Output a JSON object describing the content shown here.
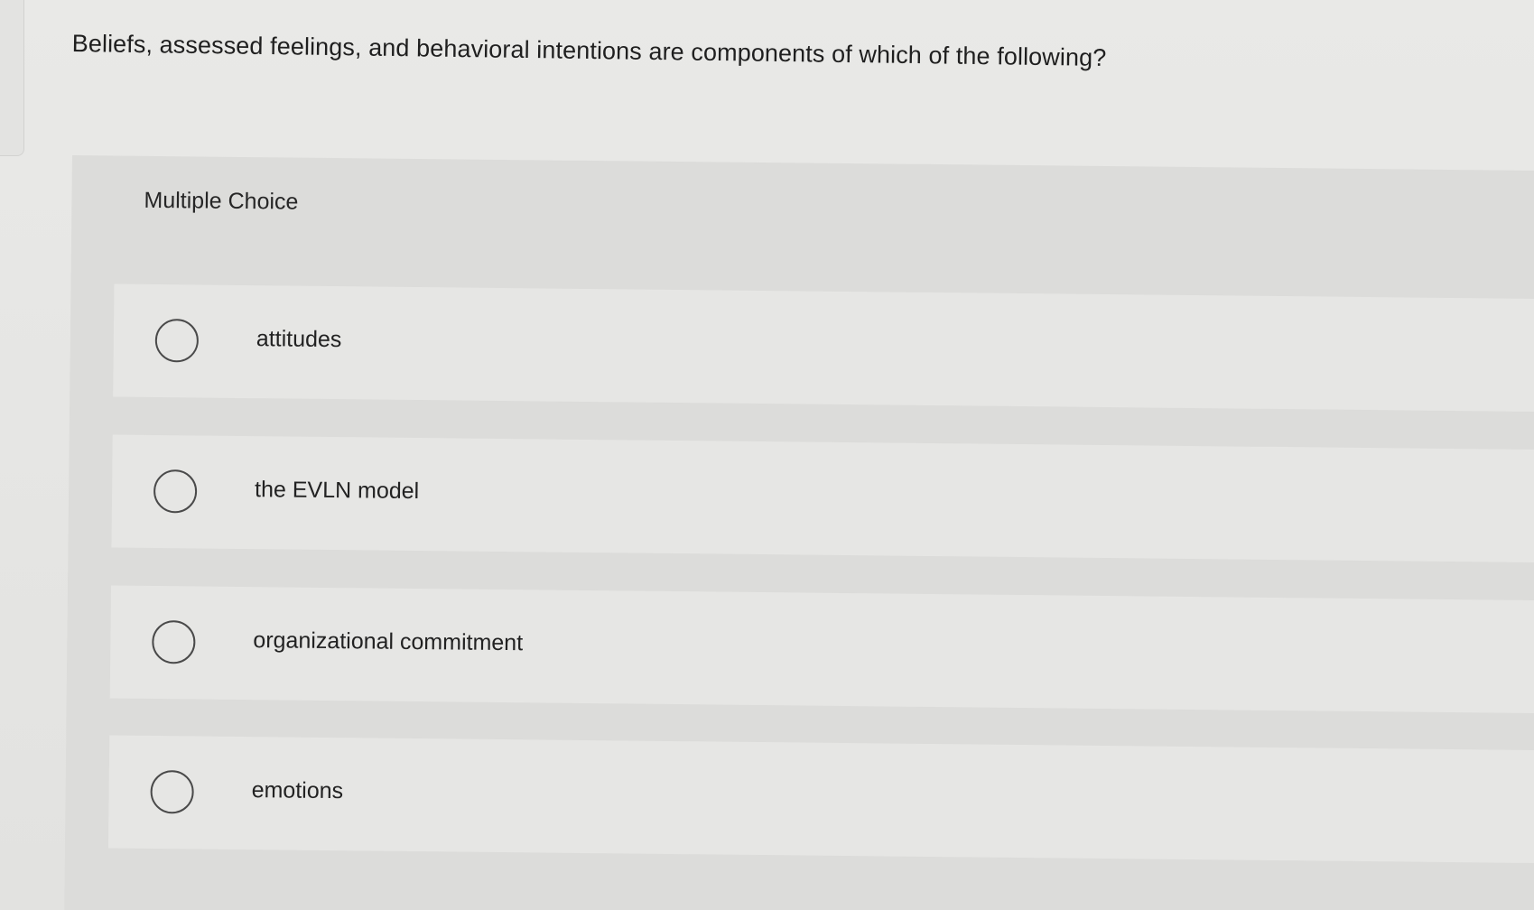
{
  "question": {
    "text": "Beliefs, assessed feelings, and behavioral intentions are components of which of the following?"
  },
  "section_label": "Multiple Choice",
  "options": [
    {
      "label": "attitudes",
      "selected": false
    },
    {
      "label": "the EVLN model",
      "selected": false
    },
    {
      "label": "organizational commitment",
      "selected": false
    },
    {
      "label": "emotions",
      "selected": false
    }
  ]
}
